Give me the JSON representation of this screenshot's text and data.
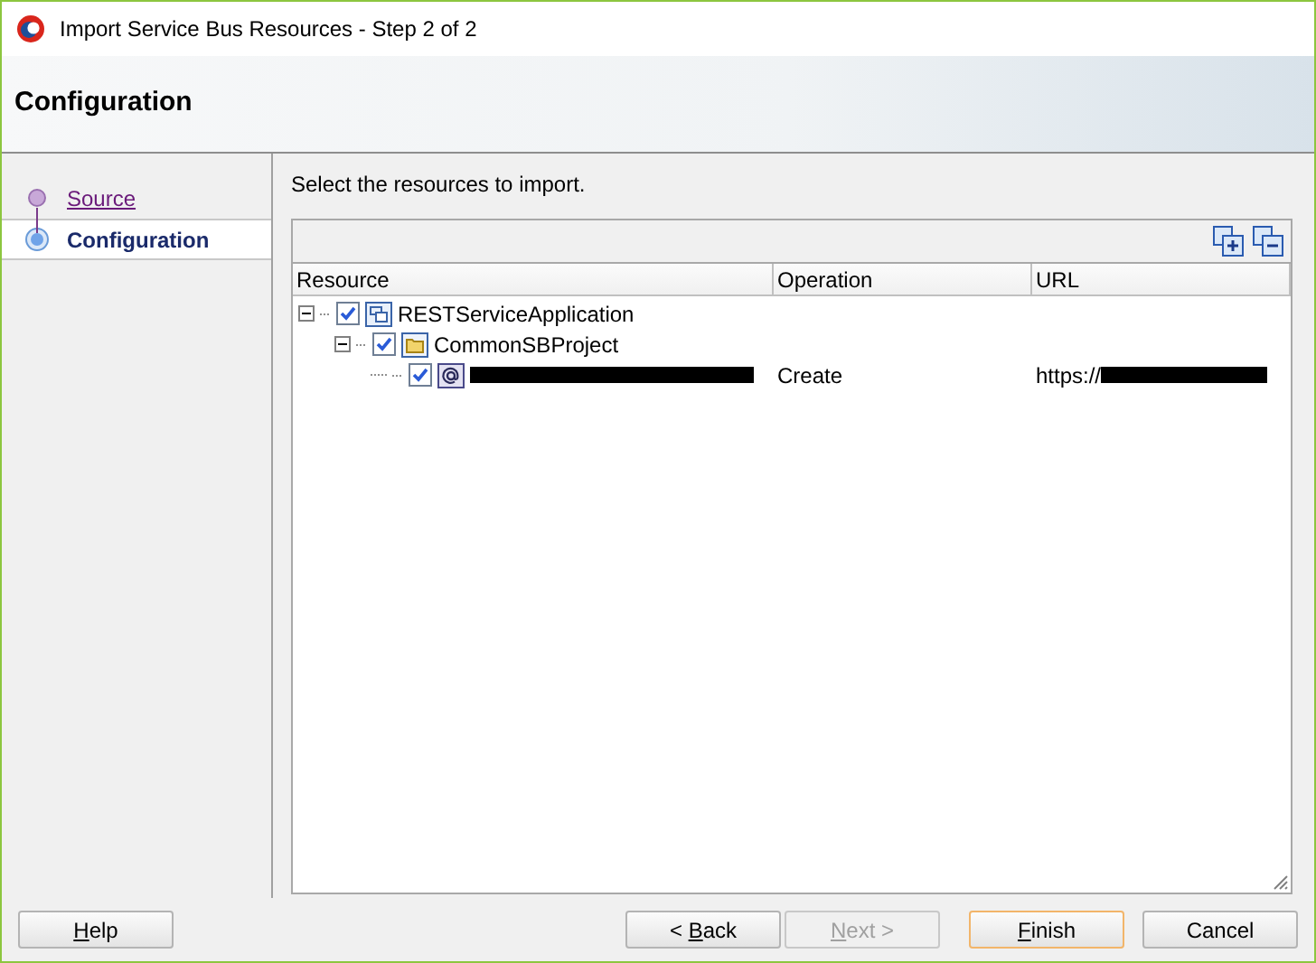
{
  "window": {
    "title": "Import Service Bus Resources - Step 2 of 2"
  },
  "header": {
    "title": "Configuration"
  },
  "steps": [
    {
      "label": "Source",
      "selected": false
    },
    {
      "label": "Configuration",
      "selected": true
    }
  ],
  "instruction": "Select the resources to import.",
  "table": {
    "columns": [
      "Resource",
      "Operation",
      "URL"
    ],
    "rows": [
      {
        "kind": "application",
        "name": "RESTServiceApplication",
        "checked": true,
        "expanded": true,
        "children": [
          {
            "kind": "project",
            "name": "CommonSBProject",
            "checked": true,
            "expanded": true,
            "children": [
              {
                "kind": "wsdl",
                "name_redacted": true,
                "checked": true,
                "operation": "Create",
                "url": "https://",
                "url_redacted": true
              }
            ]
          }
        ]
      }
    ]
  },
  "buttons": [
    {
      "key": "H",
      "after": "elp",
      "disabled": false,
      "default": false
    },
    {
      "before": "< ",
      "key": "B",
      "after": "ack",
      "disabled": false,
      "default": false
    },
    {
      "key": "N",
      "after": "ext >",
      "disabled": true,
      "default": false
    },
    {
      "key": "F",
      "after": "inish",
      "disabled": false,
      "default": true
    },
    {
      "after": "Cancel",
      "disabled": false,
      "default": false
    }
  ]
}
